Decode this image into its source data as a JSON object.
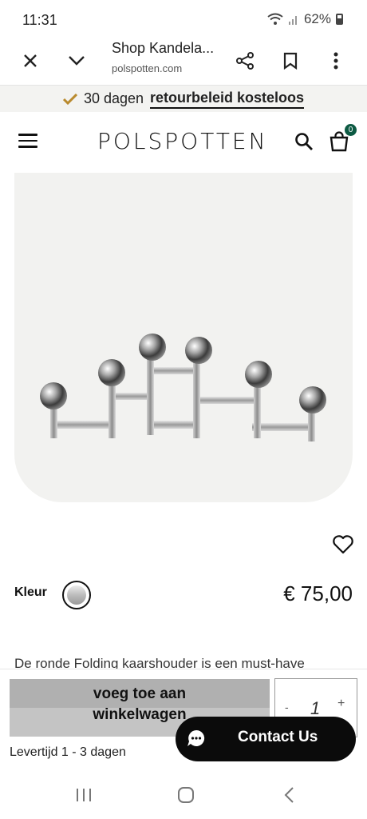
{
  "status_bar": {
    "time": "11:31",
    "battery": "62%"
  },
  "browser": {
    "title": "Shop Kandela...",
    "url": "polspotten.com",
    "icons": [
      "close-icon",
      "chevron-down-icon",
      "share-icon",
      "bookmark-icon",
      "more-vert-icon"
    ]
  },
  "promo": {
    "prefix": "30 dagen",
    "strong": "retourbeleid kosteloos"
  },
  "header": {
    "logo": "POLSPOTTEN",
    "cart_count": "0"
  },
  "product": {
    "color_label": "Kleur",
    "price": "€ 75,00",
    "description": "De ronde Folding kaarshouder is een must-have"
  },
  "purchase": {
    "add_to_cart": "voeg toe aan winkelwagen",
    "quantity": "1",
    "minus": "-",
    "plus": "+",
    "delivery": "Levertijd 1 - 3 dagen"
  },
  "contact": {
    "label": "Contact Us"
  },
  "colors": {
    "accent": "#0d5a43",
    "button_gray": "#c4c4c4",
    "contact_bg": "#0b0b0b"
  }
}
